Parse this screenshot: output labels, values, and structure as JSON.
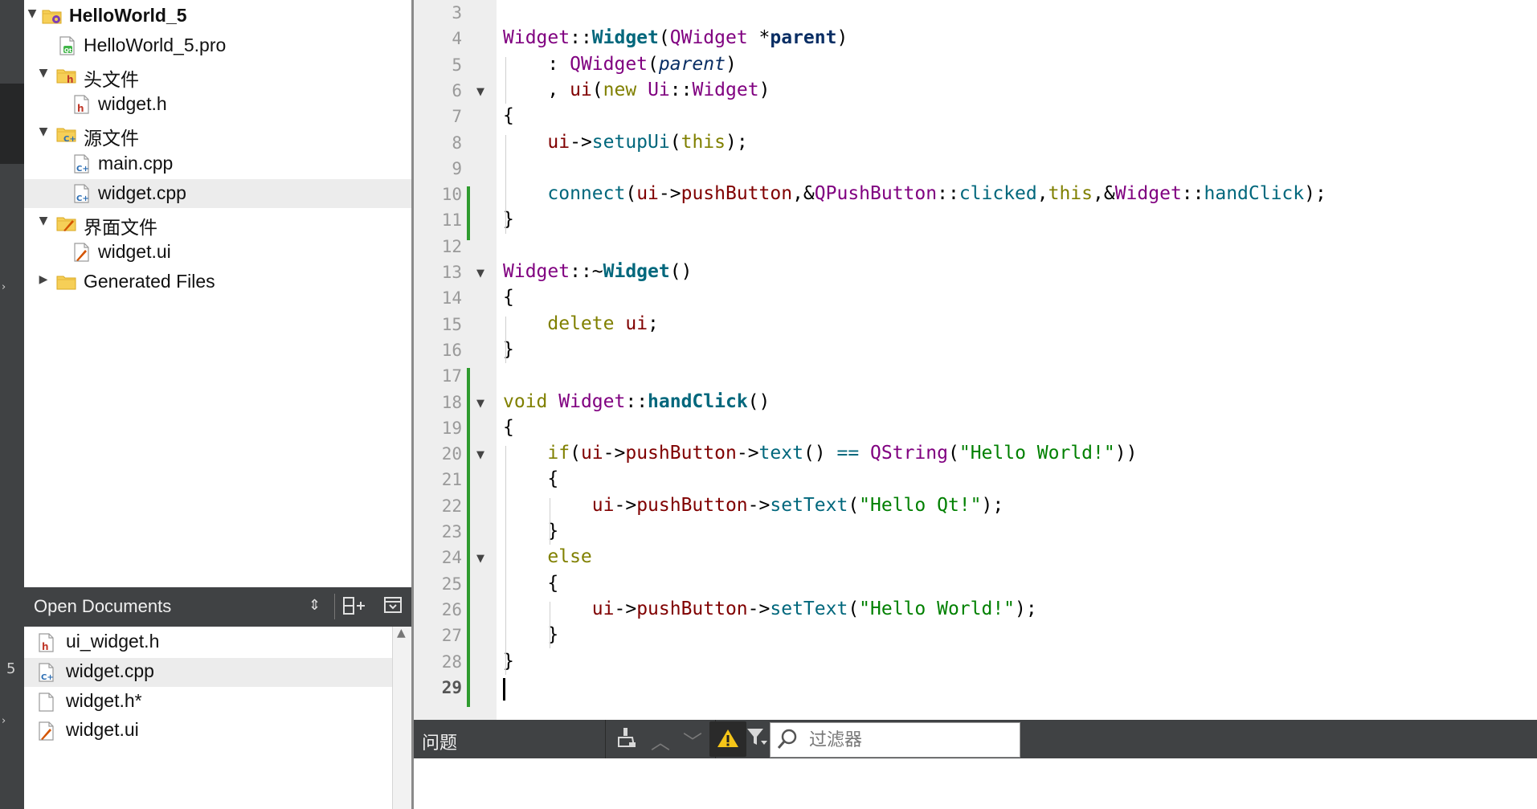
{
  "project_tree": {
    "items": [
      {
        "label": "HelloWorld_5",
        "bold": true,
        "icon": "qt-project-folder-icon",
        "arrow": "down"
      },
      {
        "label": "HelloWorld_5.pro",
        "icon": "qt-pro-file-icon",
        "arrow": ""
      },
      {
        "label": "头文件",
        "icon": "header-folder-icon",
        "arrow": "down"
      },
      {
        "label": "widget.h",
        "icon": "header-file-icon",
        "arrow": ""
      },
      {
        "label": "源文件",
        "icon": "source-folder-icon",
        "arrow": "down"
      },
      {
        "label": "main.cpp",
        "icon": "cpp-file-icon",
        "arrow": ""
      },
      {
        "label": "widget.cpp",
        "icon": "cpp-file-icon",
        "arrow": "",
        "selected": true
      },
      {
        "label": "界面文件",
        "icon": "form-folder-icon",
        "arrow": "down"
      },
      {
        "label": "widget.ui",
        "icon": "ui-file-icon",
        "arrow": ""
      },
      {
        "label": "Generated Files",
        "icon": "folder-icon",
        "arrow": "right"
      }
    ]
  },
  "open_documents": {
    "title": "Open Documents",
    "items": [
      {
        "label": "ui_widget.h",
        "icon": "header-file-icon"
      },
      {
        "label": "widget.cpp",
        "icon": "cpp-file-icon",
        "selected": true
      },
      {
        "label": "widget.h*",
        "icon": "blank-file-icon"
      },
      {
        "label": "widget.ui",
        "icon": "ui-file-icon"
      }
    ]
  },
  "mode_bar": {
    "number": "5"
  },
  "editor": {
    "current_line": 29,
    "lines": [
      {
        "n": 3,
        "tokens": []
      },
      {
        "n": 4,
        "tokens": [
          [
            "type",
            "Widget"
          ],
          [
            "plain",
            "::"
          ],
          [
            "funcb",
            "Widget"
          ],
          [
            "plain",
            "("
          ],
          [
            "type",
            "QWidget"
          ],
          [
            "plain",
            " *"
          ],
          [
            "param",
            "parent"
          ],
          [
            "plain",
            ")"
          ]
        ]
      },
      {
        "n": 5,
        "tokens": [
          [
            "plain",
            "    : "
          ],
          [
            "type",
            "QWidget"
          ],
          [
            "plain",
            "("
          ],
          [
            "parami",
            "parent"
          ],
          [
            "plain",
            ")"
          ]
        ]
      },
      {
        "n": 6,
        "fold": true,
        "tokens": [
          [
            "plain",
            "    , "
          ],
          [
            "field",
            "ui"
          ],
          [
            "plain",
            "("
          ],
          [
            "kw",
            "new"
          ],
          [
            "plain",
            " "
          ],
          [
            "type",
            "Ui"
          ],
          [
            "plain",
            "::"
          ],
          [
            "type",
            "Widget"
          ],
          [
            "plain",
            ")"
          ]
        ]
      },
      {
        "n": 7,
        "tokens": [
          [
            "plain",
            "{"
          ]
        ]
      },
      {
        "n": 8,
        "tokens": [
          [
            "plain",
            "    "
          ],
          [
            "field",
            "ui"
          ],
          [
            "plain",
            "->"
          ],
          [
            "func",
            "setupUi"
          ],
          [
            "plain",
            "("
          ],
          [
            "kw",
            "this"
          ],
          [
            "plain",
            ");"
          ]
        ]
      },
      {
        "n": 9,
        "tokens": []
      },
      {
        "n": 10,
        "tokens": [
          [
            "plain",
            "    "
          ],
          [
            "func",
            "connect"
          ],
          [
            "plain",
            "("
          ],
          [
            "field",
            "ui"
          ],
          [
            "plain",
            "->"
          ],
          [
            "field",
            "pushButton"
          ],
          [
            "plain",
            ",&"
          ],
          [
            "type",
            "QPushButton"
          ],
          [
            "plain",
            "::"
          ],
          [
            "func",
            "clicked"
          ],
          [
            "plain",
            ","
          ],
          [
            "kw",
            "this"
          ],
          [
            "plain",
            ",&"
          ],
          [
            "type",
            "Widget"
          ],
          [
            "plain",
            "::"
          ],
          [
            "func",
            "handClick"
          ],
          [
            "plain",
            ");"
          ]
        ]
      },
      {
        "n": 11,
        "tokens": [
          [
            "plain",
            "}"
          ]
        ]
      },
      {
        "n": 12,
        "tokens": []
      },
      {
        "n": 13,
        "fold": true,
        "tokens": [
          [
            "type",
            "Widget"
          ],
          [
            "plain",
            "::~"
          ],
          [
            "funcb",
            "Widget"
          ],
          [
            "plain",
            "()"
          ]
        ]
      },
      {
        "n": 14,
        "tokens": [
          [
            "plain",
            "{"
          ]
        ]
      },
      {
        "n": 15,
        "tokens": [
          [
            "plain",
            "    "
          ],
          [
            "kw",
            "delete"
          ],
          [
            "plain",
            " "
          ],
          [
            "field",
            "ui"
          ],
          [
            "plain",
            ";"
          ]
        ]
      },
      {
        "n": 16,
        "tokens": [
          [
            "plain",
            "}"
          ]
        ]
      },
      {
        "n": 17,
        "tokens": []
      },
      {
        "n": 18,
        "fold": true,
        "tokens": [
          [
            "kw",
            "void"
          ],
          [
            "plain",
            " "
          ],
          [
            "type",
            "Widget"
          ],
          [
            "plain",
            "::"
          ],
          [
            "funcb",
            "handClick"
          ],
          [
            "plain",
            "()"
          ]
        ]
      },
      {
        "n": 19,
        "tokens": [
          [
            "plain",
            "{"
          ]
        ]
      },
      {
        "n": 20,
        "fold": true,
        "tokens": [
          [
            "plain",
            "    "
          ],
          [
            "kw",
            "if"
          ],
          [
            "plain",
            "("
          ],
          [
            "field",
            "ui"
          ],
          [
            "plain",
            "->"
          ],
          [
            "field",
            "pushButton"
          ],
          [
            "plain",
            "->"
          ],
          [
            "func",
            "text"
          ],
          [
            "plain",
            "() "
          ],
          [
            "func",
            "=="
          ],
          [
            "plain",
            " "
          ],
          [
            "type",
            "QString"
          ],
          [
            "plain",
            "("
          ],
          [
            "str",
            "\"Hello World!\""
          ],
          [
            "plain",
            "))"
          ]
        ]
      },
      {
        "n": 21,
        "tokens": [
          [
            "plain",
            "    {"
          ]
        ]
      },
      {
        "n": 22,
        "tokens": [
          [
            "plain",
            "        "
          ],
          [
            "field",
            "ui"
          ],
          [
            "plain",
            "->"
          ],
          [
            "field",
            "pushButton"
          ],
          [
            "plain",
            "->"
          ],
          [
            "func",
            "setText"
          ],
          [
            "plain",
            "("
          ],
          [
            "str",
            "\"Hello Qt!\""
          ],
          [
            "plain",
            ");"
          ]
        ]
      },
      {
        "n": 23,
        "tokens": [
          [
            "plain",
            "    }"
          ]
        ]
      },
      {
        "n": 24,
        "fold": true,
        "tokens": [
          [
            "plain",
            "    "
          ],
          [
            "kw",
            "else"
          ]
        ]
      },
      {
        "n": 25,
        "tokens": [
          [
            "plain",
            "    {"
          ]
        ]
      },
      {
        "n": 26,
        "tokens": [
          [
            "plain",
            "        "
          ],
          [
            "field",
            "ui"
          ],
          [
            "plain",
            "->"
          ],
          [
            "field",
            "pushButton"
          ],
          [
            "plain",
            "->"
          ],
          [
            "func",
            "setText"
          ],
          [
            "plain",
            "("
          ],
          [
            "str",
            "\"Hello World!\""
          ],
          [
            "plain",
            ");"
          ]
        ]
      },
      {
        "n": 27,
        "tokens": [
          [
            "plain",
            "    }"
          ]
        ]
      },
      {
        "n": 28,
        "tokens": [
          [
            "plain",
            "}"
          ]
        ]
      },
      {
        "n": 29,
        "tokens": []
      }
    ]
  },
  "issues": {
    "title": "问题",
    "filter_placeholder": "过滤器",
    "icons": [
      "clear-icon",
      "previous-icon",
      "next-icon",
      "warning-filter-icon",
      "filter-icon",
      "search-icon"
    ]
  }
}
